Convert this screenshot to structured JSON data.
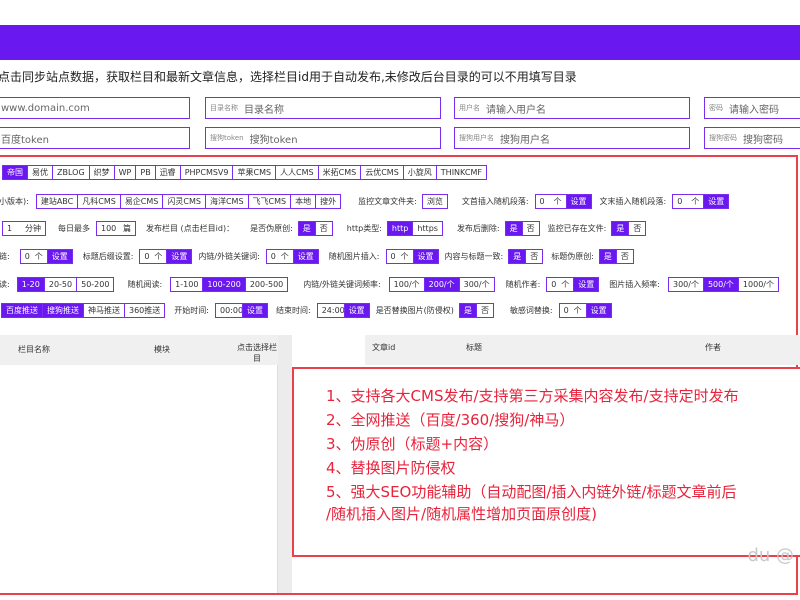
{
  "notice": "点击同步站点数据，获取栏目和最新文章信息，选择栏目id用于自动发布,未修改后台目录的可以不用填写目录",
  "fields": {
    "domain": {
      "placeholder": "www.domain.com"
    },
    "dir": {
      "label": "目录名称",
      "placeholder": "目录名称"
    },
    "user": {
      "label": "用户名",
      "placeholder": "请输入用户名"
    },
    "pass": {
      "label": "密码",
      "placeholder": "请输入密码"
    },
    "baidu": {
      "placeholder": "百度token"
    },
    "sogou_token": {
      "label": "搜狗token",
      "placeholder": "搜狗token"
    },
    "sogou_user": {
      "label": "搜狗用户名",
      "placeholder": "搜狗用户名"
    },
    "sogou_pass": {
      "label": "搜狗密码",
      "placeholder": "搜狗密码"
    }
  },
  "cms_tabs": [
    "帝国",
    "易优",
    "ZBLOG",
    "织梦",
    "WP",
    "PB",
    "迅睿",
    "PHPCMSV9",
    "苹果CMS",
    "人人CMS",
    "米拓CMS",
    "云优CMS",
    "小旋风",
    "THINKCMF"
  ],
  "row2": {
    "version_label": "小版本):",
    "versions": [
      "建站ABC",
      "凡科CMS",
      "易企CMS",
      "闪灵CMS",
      "海洋CMS",
      "飞飞CMS",
      "本地",
      "搜外"
    ],
    "monitor_label": "监控文章文件夹:",
    "browse": "浏览",
    "insert_para_label": "文首插入随机段落:",
    "insert_para_val": "0",
    "unit": "个",
    "set": "设置",
    "tail_para_label": "文末插入随机段落:",
    "tail_para_val": "0"
  },
  "row3": {
    "interval_val": "1",
    "interval_unit": "分钟",
    "daily_label": "每日最多",
    "daily_val": "100",
    "daily_unit": "篇",
    "column_label": "发布栏目 (点击栏目id)：",
    "pseudo_label": "是否伪原创:",
    "yes": "是",
    "no": "否",
    "http_label": "http类型:",
    "http": "http",
    "https": "https",
    "del_label": "发布后删除:",
    "monitor_exist_label": "监控已存在文件:"
  },
  "row4": {
    "a_label": "链:",
    "a_val": "0",
    "suffix_label": "标题后缀设置:",
    "suffix_val": "0",
    "link_kw_label": "内链/外链关键词:",
    "link_kw_val": "0",
    "img_label": "随机图片插入:",
    "img_val": "0",
    "same_label": "内容与标题一致:",
    "title_pseudo_label": "标题伪原创:"
  },
  "row5": {
    "a_label": "读:",
    "a_opts": [
      "1-20",
      "20-50",
      "50-200"
    ],
    "read_label": "随机阅读:",
    "read_opts": [
      "1-100",
      "100-200",
      "200-500"
    ],
    "kwfreq_label": "内链/外链关键词频率:",
    "kwfreq_opts": [
      "100/个",
      "200/个",
      "300/个"
    ],
    "author_label": "随机作者:",
    "author_val": "0",
    "imgfreq_label": "图片插入频率:",
    "imgfreq_opts": [
      "300/个",
      "500/个",
      "1000/个"
    ]
  },
  "row6": {
    "push": [
      "百度推送",
      "搜狗推送",
      "神马推送",
      "360推送"
    ],
    "start_label": "开始时间:",
    "start_val": "00:00",
    "end_label": "结束时间:",
    "end_val": "24:00",
    "replace_label": "是否替换图片(防侵权)",
    "sensitive_label": "敏感词替换:",
    "sensitive_val": "0"
  },
  "table_left": {
    "c1": "栏目名称",
    "c2": "模块",
    "c3": "点击选择栏目"
  },
  "table_right": {
    "c1": "文章id",
    "c2": "标题",
    "c3": "作者"
  },
  "features": [
    "1、支持各大CMS发布/支持第三方采集内容发布/支持定时发布",
    "2、全网推送（百度/360/搜狗/神马）",
    "3、伪原创（标题+内容）",
    "4、替换图片防侵权",
    "5、强大SEO功能辅助（自动配图/插入内链外链/标题文章前后",
    "/随机插入图片/随机属性增加页面原创度)"
  ],
  "watermark": "du @"
}
